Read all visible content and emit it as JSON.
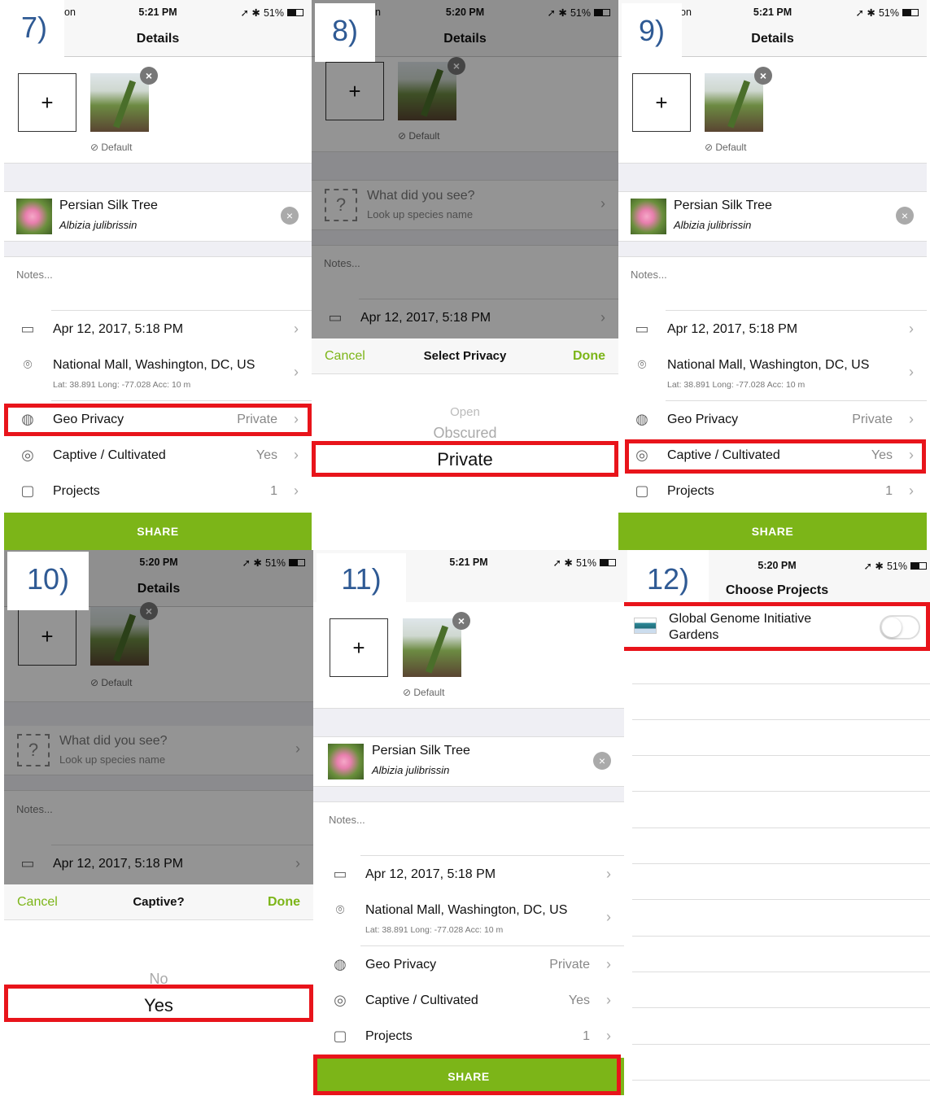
{
  "status": {
    "carrier": "on",
    "carrier_cut": "n",
    "time_a": "5:21 PM",
    "time_b": "5:20 PM",
    "battery": "51%"
  },
  "labels": {
    "details": "Details",
    "default": "Default",
    "notes": "Notes...",
    "share": "SHARE",
    "what_did_you_see": "What did you see?",
    "look_up": "Look up species name",
    "cancel": "Cancel",
    "done": "Done",
    "plus": "+"
  },
  "species": {
    "common_name": "Persian Silk Tree",
    "scientific_name": "Albizia julibrissin"
  },
  "rows": {
    "date": "Apr 12, 2017, 5:18 PM",
    "location": "National Mall, Washington, DC, US",
    "coords": "Lat: 38.891  Long: -77.028  Acc: 10 m",
    "geo_privacy_label": "Geo Privacy",
    "geo_privacy_value": "Private",
    "captive_label": "Captive / Cultivated",
    "captive_value": "Yes",
    "projects_label": "Projects",
    "projects_value": "1"
  },
  "panels": {
    "p7": {
      "step": "7)"
    },
    "p8": {
      "step": "8)",
      "sheet_title": "Select Privacy",
      "options": [
        "Open",
        "Obscured",
        "Private"
      ]
    },
    "p9": {
      "step": "9)"
    },
    "p10": {
      "step": "10)",
      "sheet_title": "Captive?",
      "options": [
        "No",
        "Yes"
      ]
    },
    "p11": {
      "step": "11)"
    },
    "p12": {
      "step": "12)",
      "title": "Choose Projects",
      "project_name": "Global Genome Initiative Gardens",
      "toggle_on": false
    }
  },
  "colors": {
    "accent_green": "#7cb518",
    "highlight_red": "#e8141b",
    "step_blue": "#2f5a94"
  }
}
